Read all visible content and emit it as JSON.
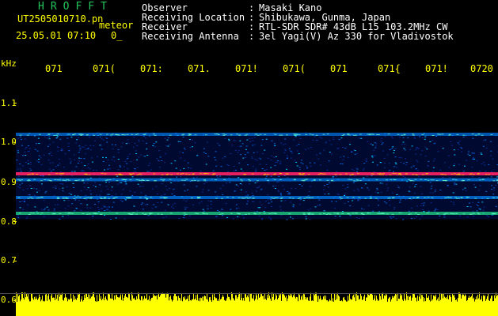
{
  "header": {
    "brand": "HROFFT",
    "filename": "UT2505010710.pn",
    "mode": "meteor",
    "date_time": "25.05.01 07:10",
    "count": "0_"
  },
  "info": {
    "labels": [
      "Observer",
      "Receiving Location",
      "Receiver",
      "Receiving Antenna"
    ],
    "values": [
      "Masaki Kano",
      "Shibukawa, Gunma, Japan",
      "RTL-SDR SDR# 43dB L15 103.2MHz CW",
      "3el Yagi(V) Az 330 for Vladivostok"
    ]
  },
  "axis": {
    "unit": "kHz",
    "y_ticks": [
      "1.1",
      "1.0",
      "0.9",
      "0.8",
      "0.7",
      "0.6"
    ],
    "x_ticks": [
      "071",
      "071(",
      "071:",
      "071.",
      "071!",
      "071(",
      "071",
      "071{",
      "071!",
      "0720"
    ]
  },
  "colors": {
    "text_yellow": "#ffff00",
    "brand_green": "#22c65a",
    "spectrum_low": "#000033",
    "spectrum_mid": "#0088ff",
    "spectrum_high": "#ff2266",
    "amplitude": "#ffff00"
  },
  "chart_data": {
    "type": "heatmap",
    "ylabel": "kHz",
    "ylim": [
      0.6,
      1.1
    ],
    "bands": [
      {
        "freq": 1.02,
        "intensity": 0.45
      },
      {
        "freq": 0.92,
        "intensity": 1.0
      },
      {
        "freq": 0.905,
        "intensity": 0.55
      },
      {
        "freq": 0.86,
        "intensity": 0.6
      },
      {
        "freq": 0.82,
        "intensity": 0.7
      }
    ]
  }
}
